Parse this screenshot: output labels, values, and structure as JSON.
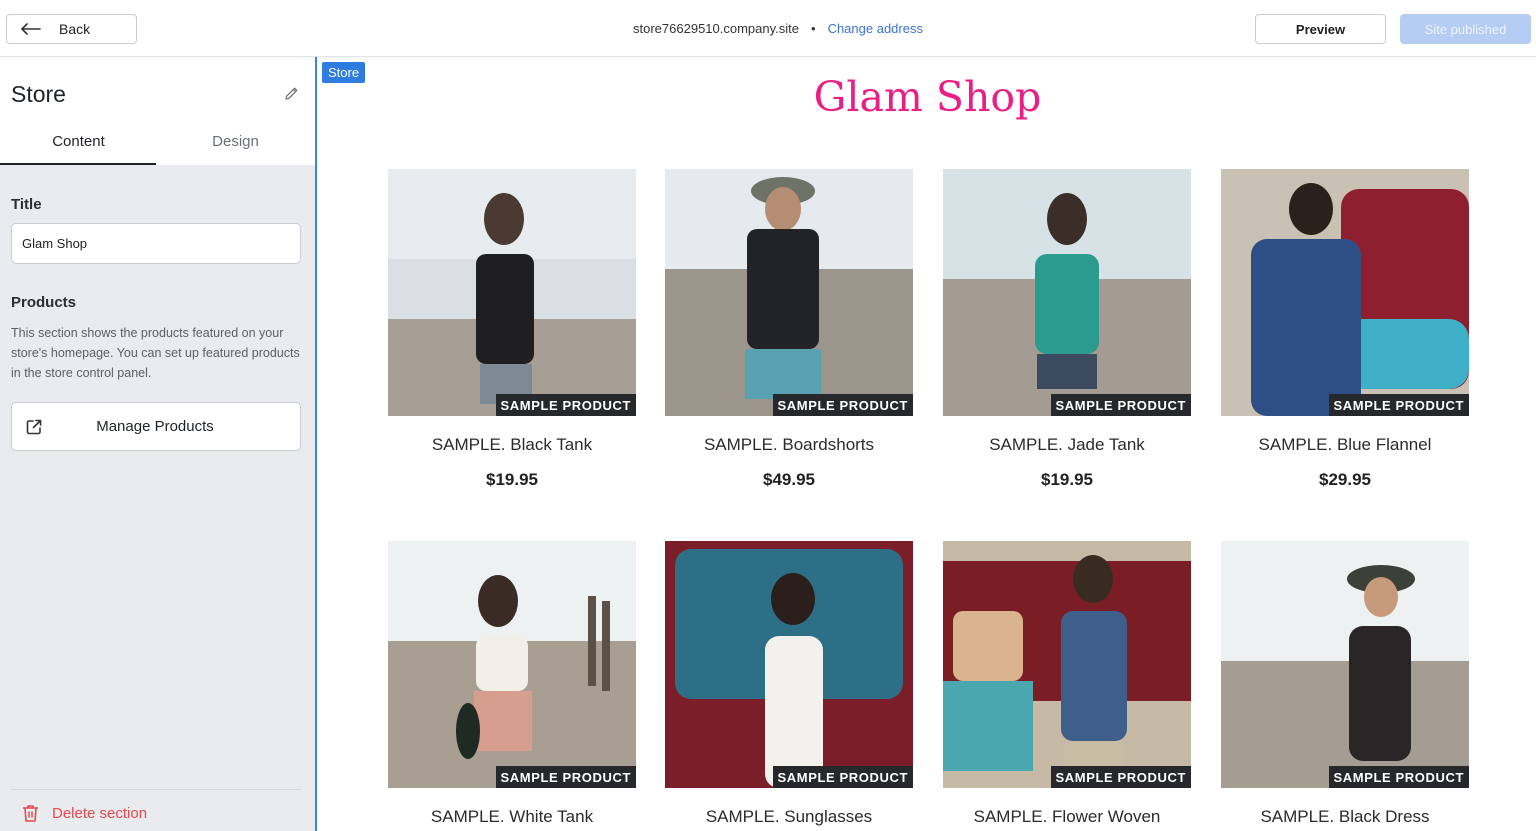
{
  "topbar": {
    "back_label": "Back",
    "site_url": "store76629510.company.site",
    "separator": "•",
    "change_address_label": "Change address",
    "preview_label": "Preview",
    "published_label": "Site published"
  },
  "sidebar": {
    "title": "Store",
    "tabs": [
      {
        "label": "Content",
        "active": true
      },
      {
        "label": "Design",
        "active": false
      }
    ],
    "title_field_label": "Title",
    "title_field_value": "Glam Shop",
    "products_label": "Products",
    "products_description": "This section shows the products featured on your store's homepage. You can set up featured products in the store control panel.",
    "manage_products_label": "Manage Products",
    "delete_section_label": "Delete section"
  },
  "canvas": {
    "section_tag": "Store",
    "shop_title": "Glam Shop",
    "badge_text": "SAMPLE PRODUCT",
    "products": [
      {
        "name": "SAMPLE. Black Tank",
        "price": "$19.95"
      },
      {
        "name": "SAMPLE. Boardshorts",
        "price": "$49.95"
      },
      {
        "name": "SAMPLE. Jade Tank",
        "price": "$19.95"
      },
      {
        "name": "SAMPLE. Blue Flannel",
        "price": "$29.95"
      },
      {
        "name": "SAMPLE. White Tank",
        "price": ""
      },
      {
        "name": "SAMPLE. Sunglasses",
        "price": ""
      },
      {
        "name": "SAMPLE. Flower Woven",
        "price": ""
      },
      {
        "name": "SAMPLE. Black Dress",
        "price": ""
      }
    ]
  },
  "colors": {
    "accent_blue": "#2f7ce0",
    "shop_title_pink": "#ea1f85",
    "delete_red": "#e5484d",
    "published_disabled": "#b6cdf3"
  }
}
